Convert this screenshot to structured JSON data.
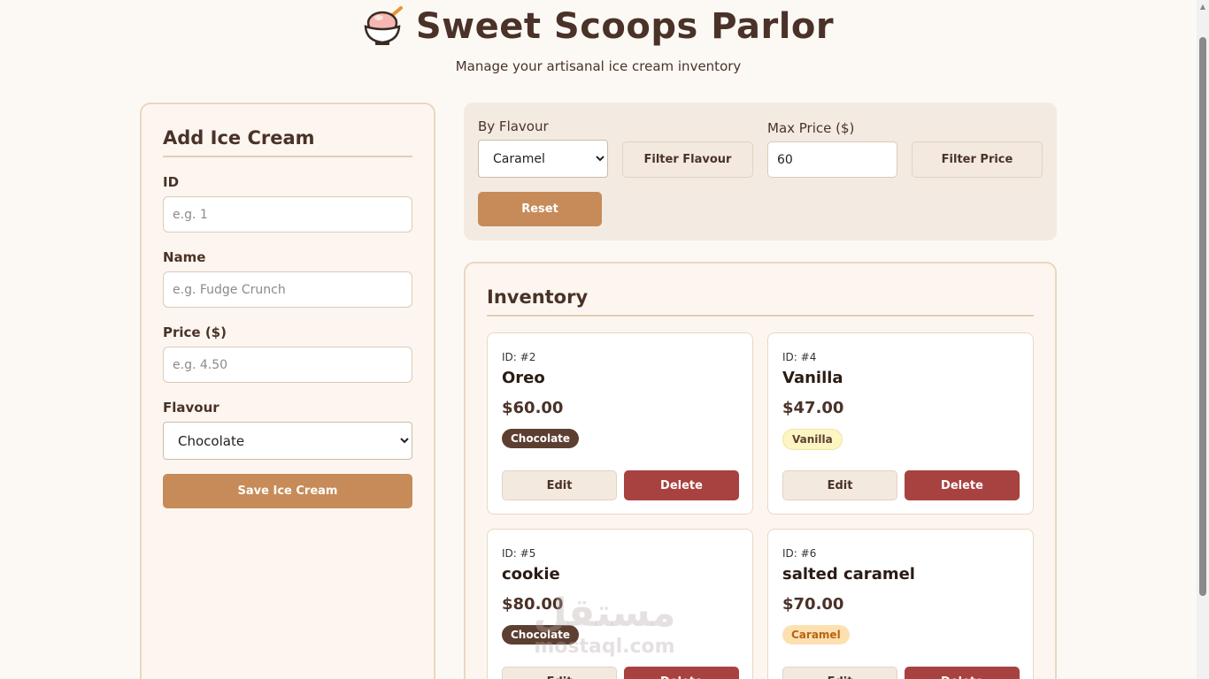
{
  "header": {
    "title": "Sweet Scoops Parlor",
    "subtitle": "Manage your artisanal ice cream inventory",
    "logo_icon": "ice-cream-bowl-icon"
  },
  "add_form": {
    "title": "Add Ice Cream",
    "fields": {
      "id": {
        "label": "ID",
        "placeholder": "e.g. 1",
        "value": ""
      },
      "name": {
        "label": "Name",
        "placeholder": "e.g. Fudge Crunch",
        "value": ""
      },
      "price": {
        "label": "Price ($)",
        "placeholder": "e.g. 4.50",
        "value": ""
      },
      "flavour": {
        "label": "Flavour",
        "selected": "Chocolate"
      }
    },
    "save_label": "Save Ice Cream"
  },
  "filters": {
    "flavour_label": "By Flavour",
    "flavour_selected": "Caramel",
    "filter_flavour_label": "Filter Flavour",
    "price_label": "Max Price ($)",
    "price_value": "60",
    "filter_price_label": "Filter Price",
    "reset_label": "Reset"
  },
  "inventory": {
    "title": "Inventory",
    "edit_label": "Edit",
    "delete_label": "Delete",
    "items": [
      {
        "id": "ID: #2",
        "name": "Oreo",
        "price": "$60.00",
        "flavour": "Chocolate"
      },
      {
        "id": "ID: #4",
        "name": "Vanilla",
        "price": "$47.00",
        "flavour": "Vanilla"
      },
      {
        "id": "ID: #5",
        "name": "cookie",
        "price": "$80.00",
        "flavour": "Chocolate"
      },
      {
        "id": "ID: #6",
        "name": "salted caramel",
        "price": "$70.00",
        "flavour": "Caramel"
      }
    ]
  },
  "watermark": {
    "arabic": "مستقل",
    "latin": "mostaql.com"
  },
  "colors": {
    "background": "#fcf9f5",
    "accent": "#c68b58",
    "danger": "#a84240",
    "text": "#4a3228",
    "badge_chocolate": "#5c3f31",
    "badge_vanilla": "#fdf6c2",
    "badge_caramel": "#fde0b0"
  }
}
